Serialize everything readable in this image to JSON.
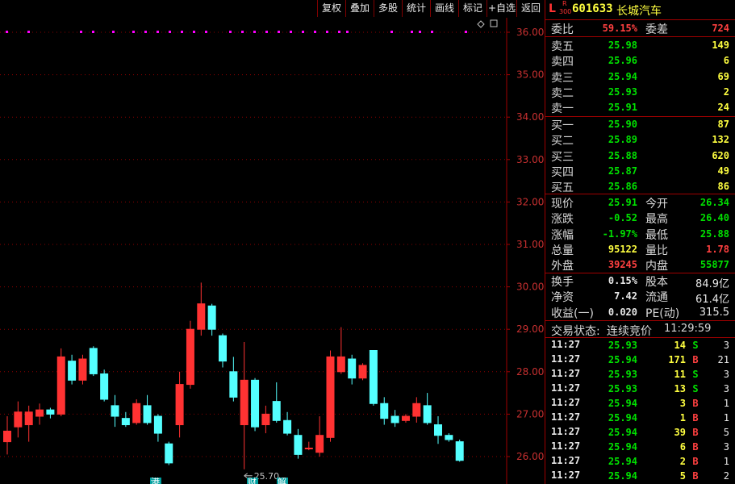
{
  "toolbar": {
    "buttons": [
      "复权",
      "叠加",
      "多股",
      "统计",
      "画线",
      "标记",
      "+自选",
      "返回"
    ]
  },
  "chart": {
    "price_labels": [
      "36.00",
      "35.00",
      "34.00",
      "33.00",
      "32.00",
      "31.00",
      "30.00",
      "29.00",
      "28.00",
      "27.00",
      "26.00"
    ],
    "low_marker": "25.70",
    "bottom_tags": [
      "港",
      "财",
      "解"
    ],
    "candles": [
      {
        "o": 26.35,
        "c": 26.6,
        "h": 26.95,
        "l": 26.05
      },
      {
        "o": 26.7,
        "c": 27.05,
        "h": 27.3,
        "l": 26.45
      },
      {
        "o": 26.75,
        "c": 27.05,
        "h": 27.2,
        "l": 26.35
      },
      {
        "o": 26.95,
        "c": 27.1,
        "h": 27.25,
        "l": 26.75
      },
      {
        "o": 27.1,
        "c": 27.0,
        "h": 27.15,
        "l": 26.9
      },
      {
        "o": 27.0,
        "c": 28.35,
        "h": 28.55,
        "l": 26.95
      },
      {
        "o": 28.25,
        "c": 27.8,
        "h": 28.4,
        "l": 27.7
      },
      {
        "o": 27.8,
        "c": 28.3,
        "h": 28.4,
        "l": 27.7
      },
      {
        "o": 28.55,
        "c": 27.95,
        "h": 28.6,
        "l": 27.9
      },
      {
        "o": 27.95,
        "c": 27.35,
        "h": 28.05,
        "l": 27.3
      },
      {
        "o": 27.2,
        "c": 26.95,
        "h": 27.45,
        "l": 26.7
      },
      {
        "o": 26.9,
        "c": 26.75,
        "h": 27.05,
        "l": 26.7
      },
      {
        "o": 26.8,
        "c": 27.25,
        "h": 27.35,
        "l": 26.75
      },
      {
        "o": 27.2,
        "c": 26.8,
        "h": 27.45,
        "l": 26.75
      },
      {
        "o": 26.95,
        "c": 26.55,
        "h": 27.0,
        "l": 26.35
      },
      {
        "o": 26.3,
        "c": 25.85,
        "h": 26.35,
        "l": 25.8
      },
      {
        "o": 26.75,
        "c": 27.7,
        "h": 28.0,
        "l": 26.45
      },
      {
        "o": 27.7,
        "c": 29.0,
        "h": 29.2,
        "l": 27.6
      },
      {
        "o": 29.0,
        "c": 29.6,
        "h": 30.1,
        "l": 28.85
      },
      {
        "o": 29.55,
        "c": 29.0,
        "h": 29.6,
        "l": 28.85
      },
      {
        "o": 28.85,
        "c": 28.25,
        "h": 28.9,
        "l": 28.1
      },
      {
        "o": 28.0,
        "c": 27.4,
        "h": 28.35,
        "l": 27.3
      },
      {
        "o": 26.75,
        "c": 27.8,
        "h": 28.7,
        "l": 25.7
      },
      {
        "o": 27.8,
        "c": 26.7,
        "h": 27.85,
        "l": 26.6
      },
      {
        "o": 26.75,
        "c": 27.0,
        "h": 27.2,
        "l": 26.55
      },
      {
        "o": 27.3,
        "c": 26.85,
        "h": 27.75,
        "l": 26.8
      },
      {
        "o": 26.85,
        "c": 26.55,
        "h": 27.05,
        "l": 26.5
      },
      {
        "o": 26.5,
        "c": 26.05,
        "h": 26.65,
        "l": 25.95
      },
      {
        "o": 26.2,
        "c": 26.2,
        "h": 26.35,
        "l": 26.15
      },
      {
        "o": 26.1,
        "c": 26.5,
        "h": 26.95,
        "l": 26.0
      },
      {
        "o": 26.45,
        "c": 28.35,
        "h": 28.5,
        "l": 26.35
      },
      {
        "o": 28.0,
        "c": 28.35,
        "h": 29.05,
        "l": 27.95
      },
      {
        "o": 28.3,
        "c": 27.85,
        "h": 28.4,
        "l": 27.7
      },
      {
        "o": 27.85,
        "c": 28.15,
        "h": 28.2,
        "l": 27.8
      },
      {
        "o": 28.5,
        "c": 27.25,
        "h": 28.5,
        "l": 27.2
      },
      {
        "o": 27.25,
        "c": 26.9,
        "h": 27.4,
        "l": 26.75
      },
      {
        "o": 26.95,
        "c": 26.8,
        "h": 27.1,
        "l": 26.7
      },
      {
        "o": 26.85,
        "c": 26.95,
        "h": 27.0,
        "l": 26.8
      },
      {
        "o": 26.95,
        "c": 27.25,
        "h": 27.4,
        "l": 26.8
      },
      {
        "o": 27.2,
        "c": 26.8,
        "h": 27.5,
        "l": 26.75
      },
      {
        "o": 26.75,
        "c": 26.5,
        "h": 26.95,
        "l": 26.3
      },
      {
        "o": 26.5,
        "c": 26.4,
        "h": 26.55,
        "l": 26.35
      },
      {
        "o": 26.35,
        "c": 25.91,
        "h": 26.4,
        "l": 25.88
      }
    ]
  },
  "panel": {
    "header": {
      "prefix": "L",
      "badge_top": "R",
      "badge_bottom": "300",
      "code": "601633",
      "name": "长城汽车"
    },
    "weibi": {
      "label": "委比",
      "value": "59.15%",
      "label2": "委差",
      "value2": "724"
    },
    "sell": [
      {
        "label": "卖五",
        "price": "25.98",
        "vol": "149"
      },
      {
        "label": "卖四",
        "price": "25.96",
        "vol": "6"
      },
      {
        "label": "卖三",
        "price": "25.94",
        "vol": "69"
      },
      {
        "label": "卖二",
        "price": "25.93",
        "vol": "2"
      },
      {
        "label": "卖一",
        "price": "25.91",
        "vol": "24"
      }
    ],
    "buy": [
      {
        "label": "买一",
        "price": "25.90",
        "vol": "87"
      },
      {
        "label": "买二",
        "price": "25.89",
        "vol": "132"
      },
      {
        "label": "买三",
        "price": "25.88",
        "vol": "620"
      },
      {
        "label": "买四",
        "price": "25.87",
        "vol": "49"
      },
      {
        "label": "买五",
        "price": "25.86",
        "vol": "86"
      }
    ],
    "quote": [
      {
        "l1": "现价",
        "v1": "25.91",
        "l2": "今开",
        "v2": "26.34"
      },
      {
        "l1": "涨跌",
        "v1": "-0.52",
        "l2": "最高",
        "v2": "26.40"
      },
      {
        "l1": "涨幅",
        "v1": "-1.97%",
        "l2": "最低",
        "v2": "25.88"
      },
      {
        "l1": "总量",
        "v1": "95122",
        "l2": "量比",
        "v2": "1.78"
      },
      {
        "l1": "外盘",
        "v1": "39245",
        "l2": "内盘",
        "v2": "55877"
      }
    ],
    "fund": [
      {
        "l1": "换手",
        "v1": "0.15%",
        "l2": "股本",
        "v2": "84.9亿"
      },
      {
        "l1": "净资",
        "v1": "7.42",
        "l2": "流通",
        "v2": "61.4亿"
      },
      {
        "l1": "收益(一)",
        "v1": "0.020",
        "l2": "PE(动)",
        "v2": "315.5"
      }
    ],
    "status": {
      "label": "交易状态:",
      "value": "连续竞价",
      "time": "11:29:59"
    },
    "ticks": [
      {
        "t": "11:27",
        "p": "25.93",
        "v": "14",
        "d": "S",
        "n": "3"
      },
      {
        "t": "11:27",
        "p": "25.94",
        "v": "171",
        "d": "B",
        "n": "21"
      },
      {
        "t": "11:27",
        "p": "25.93",
        "v": "11",
        "d": "S",
        "n": "3"
      },
      {
        "t": "11:27",
        "p": "25.93",
        "v": "13",
        "d": "S",
        "n": "3"
      },
      {
        "t": "11:27",
        "p": "25.94",
        "v": "3",
        "d": "B",
        "n": "1"
      },
      {
        "t": "11:27",
        "p": "25.94",
        "v": "1",
        "d": "B",
        "n": "1"
      },
      {
        "t": "11:27",
        "p": "25.94",
        "v": "39",
        "d": "B",
        "n": "5"
      },
      {
        "t": "11:27",
        "p": "25.94",
        "v": "6",
        "d": "B",
        "n": "3"
      },
      {
        "t": "11:27",
        "p": "25.94",
        "v": "2",
        "d": "B",
        "n": "1"
      },
      {
        "t": "11:27",
        "p": "25.94",
        "v": "5",
        "d": "B",
        "n": "2"
      }
    ]
  }
}
